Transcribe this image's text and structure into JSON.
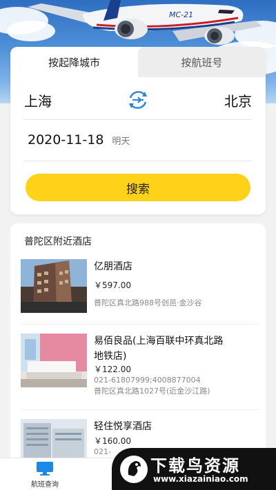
{
  "hero": {
    "plane_text": "MC-21"
  },
  "search": {
    "tabs": [
      {
        "label": "按起降城市",
        "active": true
      },
      {
        "label": "按航班号",
        "active": false
      }
    ],
    "from_city": "上海",
    "to_city": "北京",
    "date": "2020-11-18",
    "date_hint": "明天",
    "button_label": "搜索",
    "accent_color": "#ffd21a",
    "swap_icon_color": "#2a86d6"
  },
  "hotels": {
    "title": "普陀区附近酒店",
    "items": [
      {
        "name": "亿朋酒店",
        "name_line2": "",
        "price": "￥597.00",
        "phone": "",
        "address": "普陀区真北路988号创邑·金沙谷"
      },
      {
        "name": "易佰良品(上海百联中环真北路",
        "name_line2": "地铁店)",
        "price": "￥122.00",
        "phone": "021-61807999;4008877004",
        "address": "普陀区真北路1027号(近金沙江路)"
      },
      {
        "name": "轻住悦享酒店",
        "name_line2": "",
        "price": "￥160.00",
        "phone": "021-",
        "address": ""
      }
    ]
  },
  "nav": {
    "items": [
      {
        "label": "航班查询",
        "icon": "monitor-icon",
        "color": "#1e88e5"
      }
    ]
  },
  "watermark": {
    "brand": "下载鸟资源",
    "url": "www.xiazainiao.com"
  }
}
